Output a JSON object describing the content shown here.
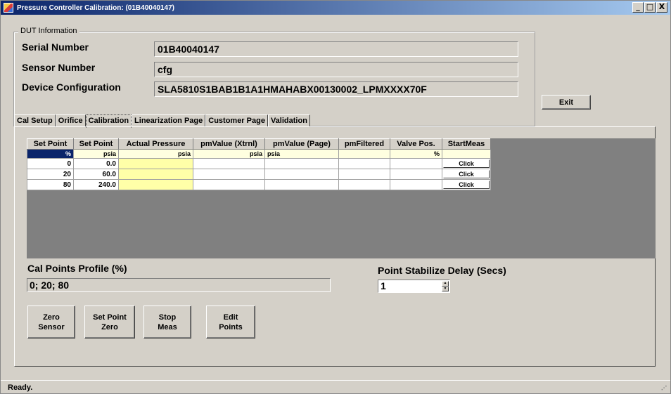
{
  "window": {
    "title": "Pressure Controller Calibration: (01B40040147)",
    "buttons": {
      "minimize": "_",
      "maximize": "□",
      "close": "X"
    }
  },
  "dut": {
    "legend": "DUT Information",
    "serial_label": "Serial Number",
    "serial_value": "01B40040147",
    "sensor_label": "Sensor Number",
    "sensor_value": "cfg",
    "config_label": "Device Configuration",
    "config_value": "SLA5810S1BAB1B1A1HMAHABX00130002_LPMXXXX70F"
  },
  "exit_label": "Exit",
  "tabs": [
    {
      "label": "Cal Setup"
    },
    {
      "label": "Orifice"
    },
    {
      "label": "Calibration",
      "active": true
    },
    {
      "label": "Linearization Page"
    },
    {
      "label": "Customer Page"
    },
    {
      "label": "Validation"
    }
  ],
  "grid": {
    "headers": [
      "Set Point",
      "Set Point",
      "Actual Pressure",
      "pmValue (Xtrnl)",
      "pmValue (Page)",
      "pmFiltered",
      "Valve Pos.",
      "StartMeas"
    ],
    "units": [
      "%",
      "psia",
      "psia",
      "psia",
      "psia",
      "",
      "%",
      ""
    ],
    "rows": [
      {
        "sp_pct": "0",
        "sp_psia": "0.0",
        "button": "Click"
      },
      {
        "sp_pct": "20",
        "sp_psia": "60.0",
        "button": "Click"
      },
      {
        "sp_pct": "80",
        "sp_psia": "240.0",
        "button": "Click"
      }
    ]
  },
  "cal_points": {
    "label": "Cal Points Profile (%)",
    "value": "0; 20; 80"
  },
  "stabilize": {
    "label": "Point Stabilize Delay (Secs)",
    "value": "1"
  },
  "actions": {
    "zero_sensor": "Zero\nSensor",
    "set_point_zero": "Set Point\nZero",
    "stop_meas": "Stop\nMeas",
    "edit_points": "Edit\nPoints"
  },
  "status": "Ready."
}
